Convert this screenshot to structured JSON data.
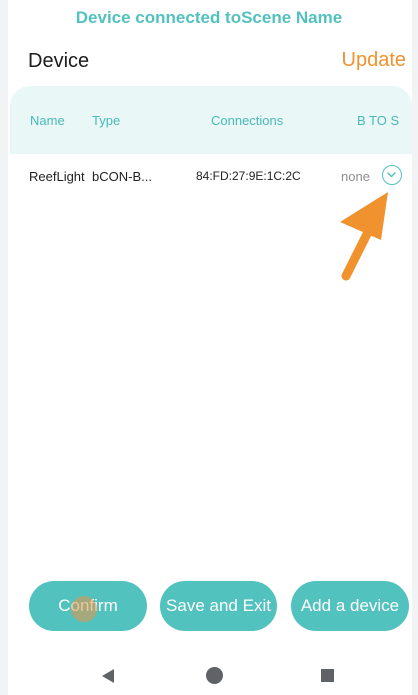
{
  "banner": "Device connected toScene Name",
  "header": {
    "title": "Device",
    "update_label": "Update"
  },
  "table": {
    "columns": {
      "name": "Name",
      "type": "Type",
      "connections": "Connections",
      "btos": "B TO S"
    },
    "rows": [
      {
        "name": "ReefLight",
        "type": "bCON-B...",
        "connections": "84:FD:27:9E:1C:2C",
        "btos": "none"
      }
    ]
  },
  "buttons": {
    "confirm": "Confirm",
    "save_exit": "Save and Exit",
    "add_device": "Add a device"
  },
  "colors": {
    "accent": "#52c2bf",
    "update": "#f0922e",
    "annotation_arrow": "#f0922e",
    "header_bg": "#e9f7f7"
  },
  "icons": {
    "row_action": "check-circle-icon",
    "nav_back": "triangle-back-icon",
    "nav_home": "circle-home-icon",
    "nav_recents": "square-recents-icon"
  }
}
